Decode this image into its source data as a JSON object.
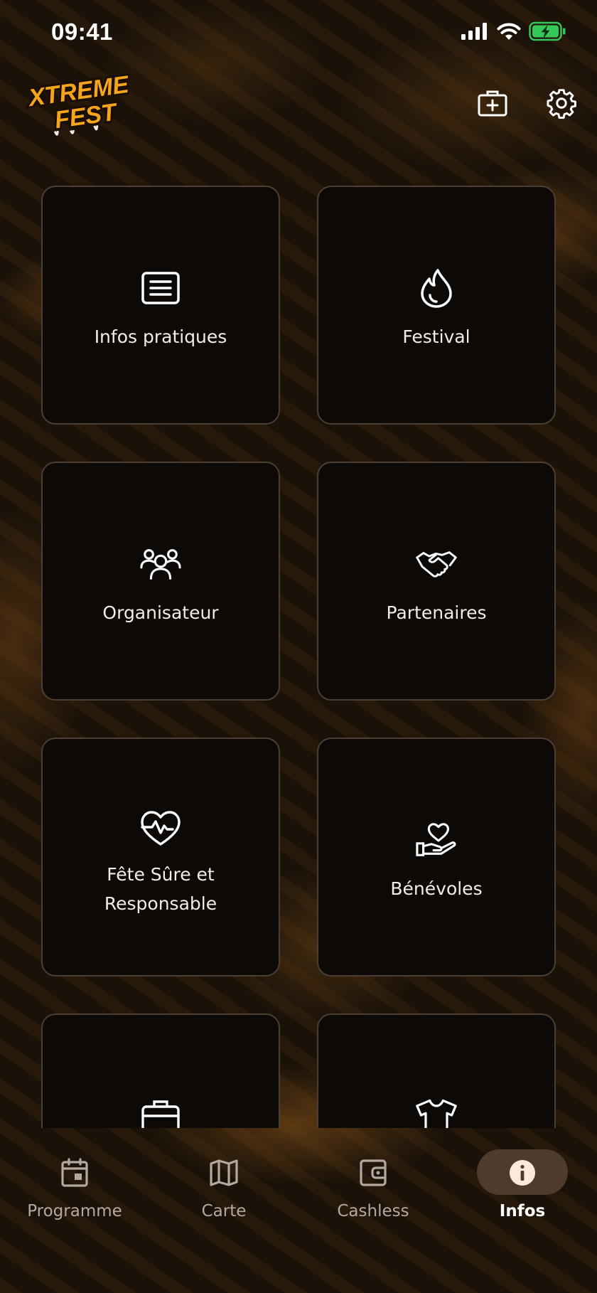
{
  "status_bar": {
    "time": "09:41",
    "icons": [
      "cellular-signal-icon",
      "wifi-icon",
      "battery-charging-icon"
    ]
  },
  "header": {
    "logo": {
      "line1": "XTREME",
      "line2": "FEST"
    },
    "actions": [
      {
        "icon": "first-aid-kit-icon"
      },
      {
        "icon": "gear-icon"
      }
    ]
  },
  "tiles": [
    {
      "label": "Infos pratiques",
      "icon": "document-lines-icon"
    },
    {
      "label": "Festival",
      "icon": "flame-icon"
    },
    {
      "label": "Organisateur",
      "icon": "users-group-icon"
    },
    {
      "label": "Partenaires",
      "icon": "handshake-icon"
    },
    {
      "label": "Fête Sûre et",
      "label2": "Responsable",
      "icon": "heart-pulse-icon"
    },
    {
      "label": "Bénévoles",
      "icon": "hand-heart-icon"
    },
    {
      "label": "",
      "icon": "briefcase-icon"
    },
    {
      "label": "",
      "icon": "t-shirt-icon"
    }
  ],
  "tab_bar": {
    "tabs": [
      {
        "label": "Programme",
        "icon": "calendar-icon",
        "active": false
      },
      {
        "label": "Carte",
        "icon": "map-icon",
        "active": false
      },
      {
        "label": "Cashless",
        "icon": "wallet-icon",
        "active": false
      },
      {
        "label": "Infos",
        "icon": "info-icon",
        "active": true
      }
    ]
  },
  "colors": {
    "background": "#1c130a",
    "tile": "#0d0907",
    "tile_border": "#4a3e35",
    "active_pill": "#4f3b2b",
    "logo_orange": "#f5a51c",
    "battery_green": "#34c759"
  }
}
